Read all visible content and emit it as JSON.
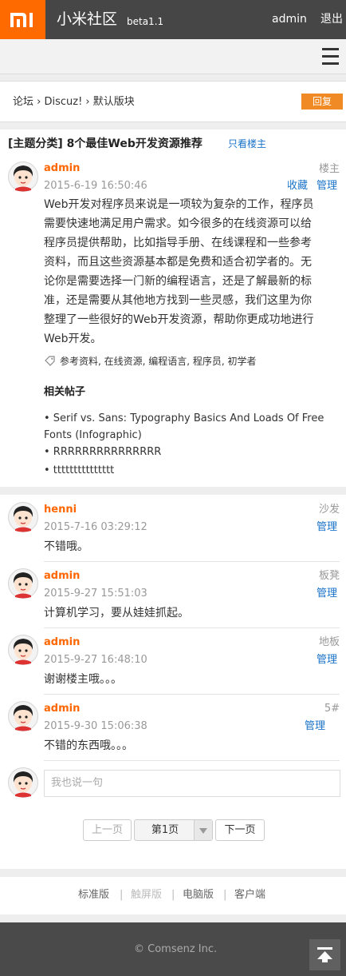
{
  "header": {
    "logo_icon": "mi-logo-icon",
    "site_title": "小米社区",
    "version": "beta1.1",
    "username": "admin",
    "logout": "退出",
    "brand_color": "#ff6a00"
  },
  "nav": {
    "menu_icon": "hamburger-menu-icon"
  },
  "breadcrumb": {
    "text": "论坛 › Discuz! › 默认版块",
    "reply_button": "回复",
    "reply_color": "#f08a24"
  },
  "thread": {
    "title": "[主题分类] 8个最佳Web开发资源推荐",
    "only_op": "只看楼主",
    "first_post": {
      "author": "admin",
      "time": "2015-6-19 16:50:46",
      "floor": "楼主",
      "favorite": "收藏",
      "manage": "管理",
      "content_lines": [
        "Web开发对程序员来说是一项较为复杂的工作，程序员",
        "需要快速地满足用户需求。如今很多的在线资源可以给",
        "程序员提供帮助，比如指导手册、在线课程和一些参考",
        "资料，而且这些资源基本都是免费和适合初学者的。无",
        "论你是需要选择一门新的编程语言，还是了解最新的标",
        "准，还是需要从其他地方找到一些灵感，我们这里为你",
        "整理了一些很好的Web开发资源，帮助你更成功地进行",
        "Web开发。"
      ],
      "tags": "参考资料, 在线资源, 编程语言, 程序员, 初学者",
      "related_title": "相关帖子",
      "related_lines": [
        "• Serif vs. Sans: Typography Basics And Loads Of Free",
        "Fonts (Infographic)",
        "• RRRRRRRRRRRRRRR",
        "• ttttttttttttttt"
      ]
    }
  },
  "replies": [
    {
      "author": "henni",
      "time": "2015-7-16 03:29:12",
      "floor": "沙发",
      "manage": "管理",
      "content": "不错哦。"
    },
    {
      "author": "admin",
      "time": "2015-9-27 15:51:03",
      "floor": "板凳",
      "manage": "管理",
      "content": "计算机学习，要从娃娃抓起。"
    },
    {
      "author": "admin",
      "time": "2015-9-27 16:48:10",
      "floor": "地板",
      "manage": "管理",
      "content": "谢谢楼主哦。。。"
    },
    {
      "author": "admin",
      "time": "2015-9-30 15:06:38",
      "floor": "5#",
      "manage": "管理",
      "content": "不错的东西哦。。。"
    }
  ],
  "quick_reply": {
    "placeholder": "我也说一句"
  },
  "pager": {
    "prev": "上一页",
    "current": "第1页",
    "next": "下一页"
  },
  "footer": {
    "links": [
      "标准版",
      "触屏版",
      "电脑版",
      "客户端"
    ],
    "separator": "|",
    "copyright": "© Comsenz Inc.",
    "to_top_icon": "back-to-top-icon"
  }
}
